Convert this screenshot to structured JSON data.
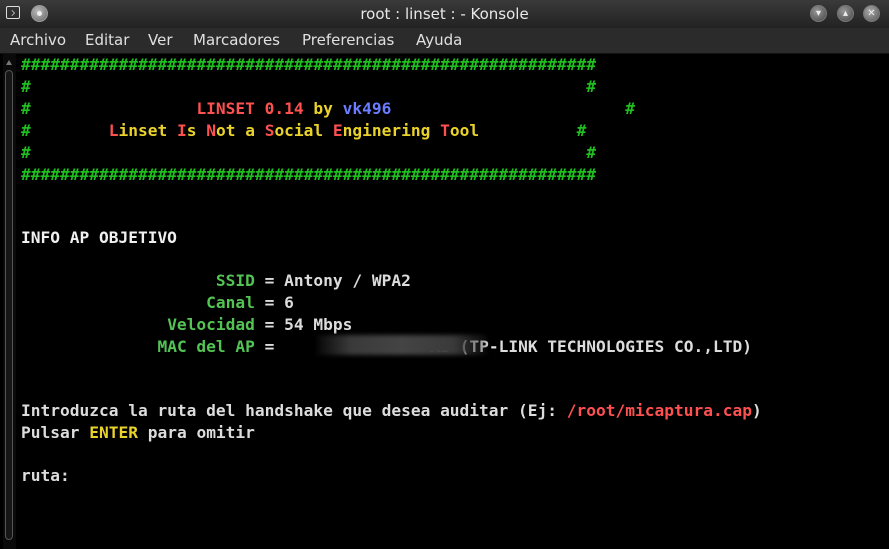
{
  "window": {
    "title": "root : linset : - Konsole",
    "controls": [
      "window-menu-icon",
      "pin-icon",
      "minimize-icon",
      "maximize-icon",
      "close-icon"
    ]
  },
  "menubar": {
    "items": [
      "Archivo",
      "Editar",
      "Ver",
      "Marcadores",
      "Preferencias",
      "Ayuda"
    ]
  },
  "terminal": {
    "banner_border": "###########################################################",
    "banner_side": "#",
    "banner_title_name": "LINSET 0.14",
    "banner_title_by": "by",
    "banner_title_author": "vk496",
    "banner_subtitle": [
      {
        "text": "L",
        "color": "red"
      },
      {
        "text": "inset ",
        "color": "yellow"
      },
      {
        "text": "I",
        "color": "red"
      },
      {
        "text": "s ",
        "color": "yellow"
      },
      {
        "text": "N",
        "color": "red"
      },
      {
        "text": "ot a ",
        "color": "yellow"
      },
      {
        "text": "S",
        "color": "red"
      },
      {
        "text": "ocial ",
        "color": "yellow"
      },
      {
        "text": "E",
        "color": "red"
      },
      {
        "text": "nginering ",
        "color": "yellow"
      },
      {
        "text": "T",
        "color": "red"
      },
      {
        "text": "ool",
        "color": "yellow"
      }
    ],
    "section_header": "INFO AP OBJETIVO",
    "ssid_label": "SSID",
    "ssid_value": "Antony / WPA2",
    "canal_label": "Canal",
    "canal_value": "6",
    "velocidad_label": "Velocidad",
    "velocidad_value": "54 Mbps",
    "mac_label": "MAC del AP",
    "mac_value_suffix": "A2 (TP-LINK TECHNOLOGIES CO.,LTD)",
    "equals": "=",
    "prompt_line1": "Introduzca la ruta del handshake que desea auditar (Ej: ",
    "prompt_example_path": "/root/micaptura.cap",
    "prompt_line1_end": ")",
    "prompt_line2_start": "Pulsar ",
    "prompt_line2_key": "ENTER",
    "prompt_line2_end": " para omitir",
    "input_prompt": "ruta:"
  },
  "colors": {
    "border": "#1fbf1f",
    "red": "#ff5050",
    "blue": "#6a7cff",
    "label_green": "#53c453",
    "yellow": "#e9d22a",
    "text": "#dcdcdc"
  }
}
